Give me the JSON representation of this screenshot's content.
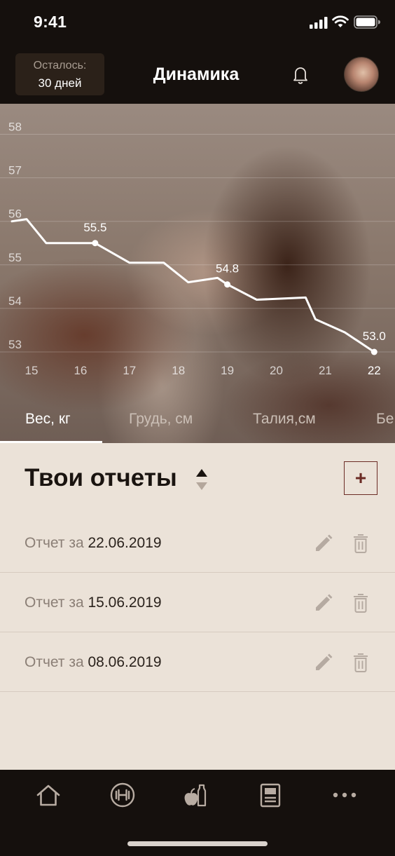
{
  "status_bar": {
    "time": "9:41"
  },
  "header": {
    "remaining_label": "Осталось:",
    "remaining_value": "30 дней",
    "title": "Динамика"
  },
  "chart_data": {
    "type": "line",
    "title": "",
    "xlabel": "",
    "ylabel": "",
    "x_ticks": [
      "15",
      "16",
      "17",
      "18",
      "19",
      "20",
      "21",
      "22"
    ],
    "y_ticks": [
      "53",
      "54",
      "55",
      "56",
      "57",
      "58"
    ],
    "ylim": [
      53,
      58
    ],
    "xlim": [
      14.6,
      22.2
    ],
    "grid": true,
    "line_color": "#ffffff",
    "series": [
      {
        "x": [
          14.6,
          14.9,
          15.3,
          16.3,
          17.0,
          17.7,
          18.2,
          18.8,
          19.0,
          19.6,
          20.6,
          20.8,
          21.4,
          22.0
        ],
        "values": [
          56.0,
          56.05,
          55.5,
          55.5,
          55.05,
          55.05,
          54.6,
          54.7,
          54.55,
          54.2,
          54.25,
          53.75,
          53.45,
          53.0
        ]
      }
    ],
    "data_labels": [
      {
        "x": 16.3,
        "y": 55.5,
        "text": "55.5"
      },
      {
        "x": 19.0,
        "y": 54.55,
        "text": "54.8"
      },
      {
        "x": 22.0,
        "y": 53.0,
        "text": "53.0"
      }
    ]
  },
  "tabs": [
    {
      "label": "Вес, кг",
      "active": true
    },
    {
      "label": "Грудь, см",
      "active": false
    },
    {
      "label": "Талия,см",
      "active": false
    },
    {
      "label": "Бе",
      "active": false
    }
  ],
  "reports": {
    "title": "Твои отчеты",
    "add_label": "+",
    "items": [
      {
        "prefix": "Отчет за",
        "date": "22.06.2019"
      },
      {
        "prefix": "Отчет за",
        "date": "15.06.2019"
      },
      {
        "prefix": "Отчет за",
        "date": "08.06.2019"
      }
    ]
  },
  "bottom_nav": [
    {
      "icon": "home-icon"
    },
    {
      "icon": "dumbbell-icon"
    },
    {
      "icon": "nutrition-icon"
    },
    {
      "icon": "article-icon"
    },
    {
      "icon": "more-icon"
    }
  ],
  "colors": {
    "accent": "#6b2c25",
    "background": "#ebe2d8",
    "bar_dark": "#15100d"
  }
}
